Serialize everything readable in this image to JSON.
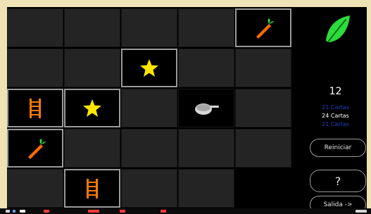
{
  "board": {
    "cells": [
      {
        "row": 0,
        "col": 0,
        "state": "hidden"
      },
      {
        "row": 0,
        "col": 1,
        "state": "hidden"
      },
      {
        "row": 0,
        "col": 2,
        "state": "hidden"
      },
      {
        "row": 0,
        "col": 3,
        "state": "hidden"
      },
      {
        "row": 0,
        "col": 4,
        "state": "revealed",
        "icon": "carrot-icon"
      },
      {
        "row": 1,
        "col": 0,
        "state": "hidden"
      },
      {
        "row": 1,
        "col": 1,
        "state": "hidden"
      },
      {
        "row": 1,
        "col": 2,
        "state": "revealed",
        "icon": "star-icon"
      },
      {
        "row": 1,
        "col": 3,
        "state": "hidden"
      },
      {
        "row": 1,
        "col": 4,
        "state": "hidden"
      },
      {
        "row": 2,
        "col": 0,
        "state": "revealed",
        "icon": "ladder-icon"
      },
      {
        "row": 2,
        "col": 1,
        "state": "revealed",
        "icon": "star-icon"
      },
      {
        "row": 2,
        "col": 2,
        "state": "hidden"
      },
      {
        "row": 2,
        "col": 3,
        "state": "matched",
        "icon": "pan-icon"
      },
      {
        "row": 2,
        "col": 4,
        "state": "hidden"
      },
      {
        "row": 3,
        "col": 0,
        "state": "revealed",
        "icon": "carrot-icon"
      },
      {
        "row": 3,
        "col": 1,
        "state": "hidden"
      },
      {
        "row": 3,
        "col": 2,
        "state": "hidden"
      },
      {
        "row": 3,
        "col": 3,
        "state": "hidden"
      },
      {
        "row": 3,
        "col": 4,
        "state": "hidden"
      },
      {
        "row": 4,
        "col": 0,
        "state": "hidden"
      },
      {
        "row": 4,
        "col": 1,
        "state": "revealed",
        "icon": "ladder-icon"
      },
      {
        "row": 4,
        "col": 2,
        "state": "hidden"
      },
      {
        "row": 4,
        "col": 3,
        "state": "hidden"
      },
      {
        "row": 4,
        "col": 4,
        "state": "empty"
      }
    ],
    "colors": {
      "carrot": "#ff6a00",
      "star": "#ffe600",
      "ladder": "#ff7a00",
      "pan": "#d8d8d8"
    }
  },
  "side": {
    "leaf_color": "#2bdc3a",
    "counter": "12",
    "line1": "21 Cartas",
    "line2": "24 Cartas",
    "line3": "21 Cartas",
    "buttons": {
      "restart": "Reiniciar",
      "help": "?",
      "exit": "Salida ->"
    }
  }
}
